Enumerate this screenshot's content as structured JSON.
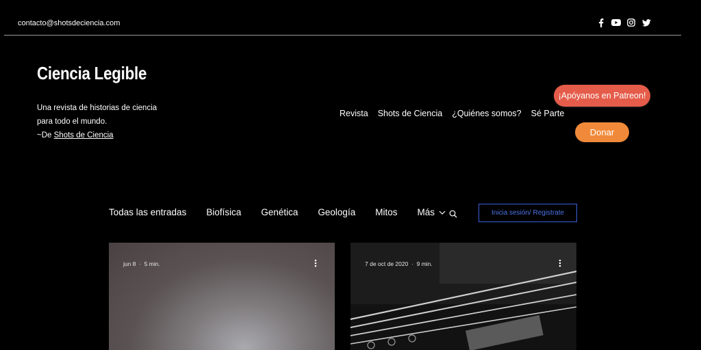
{
  "topbar": {
    "email": "contacto@shotsdeciencia.com",
    "social_icons": [
      "facebook-icon",
      "youtube-icon",
      "instagram-icon",
      "twitter-icon"
    ]
  },
  "header": {
    "site_title": "Ciencia Legible",
    "tagline_line1": "Una revista de historias de ciencia",
    "tagline_line2": "para todo el mundo.",
    "tagline_prefix": "~De ",
    "tagline_link": "Shots de Ciencia"
  },
  "main_nav": [
    {
      "label": "Revista"
    },
    {
      "label": "Shots de Ciencia"
    },
    {
      "label": "¿Quiénes somos?"
    },
    {
      "label": "Sé Parte"
    }
  ],
  "buttons": {
    "patreon": "¡Apóyanos en Patreon!",
    "donar": "Donar",
    "login": "Inicia sesión/ Registrate"
  },
  "blog_menu": {
    "items": [
      {
        "label": "Todas las entradas"
      },
      {
        "label": "Biofísica"
      },
      {
        "label": "Genética"
      },
      {
        "label": "Geología"
      },
      {
        "label": "Mitos"
      }
    ],
    "more_label": "Más"
  },
  "posts": [
    {
      "date": "jun 8",
      "read_time": "5 min."
    },
    {
      "date": "7 de oct de 2020",
      "read_time": "9 min."
    }
  ],
  "colors": {
    "patreon": "#e55c4a",
    "donar": "#f08a3a",
    "login_border": "#3b5fd9"
  }
}
